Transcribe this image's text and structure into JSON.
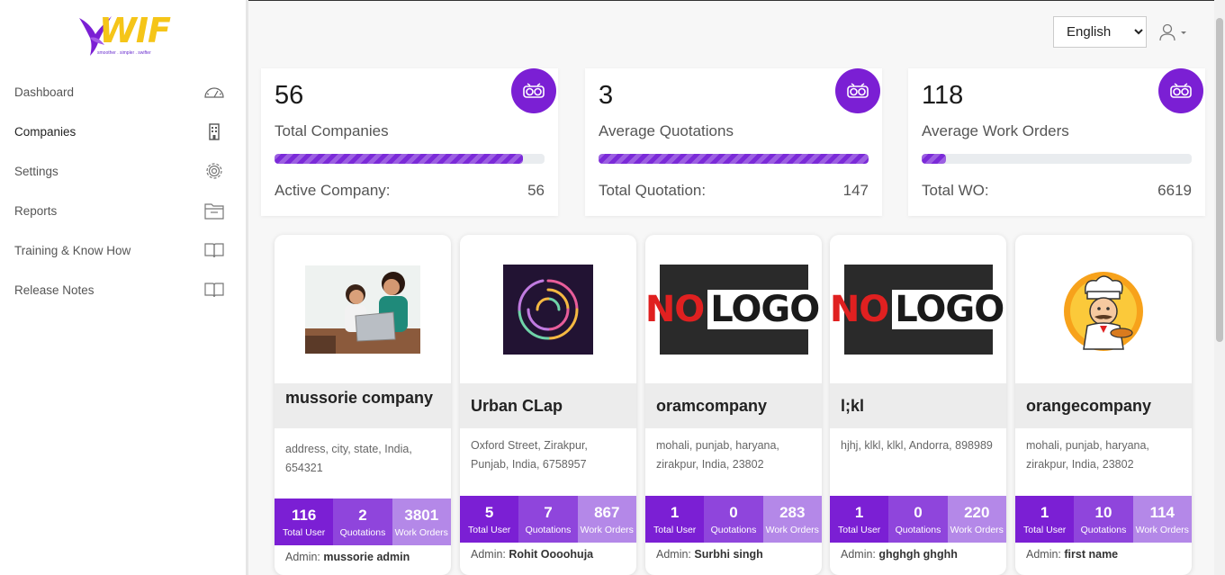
{
  "brand": {
    "name": "WIF",
    "tagline": "smoother . simpler . swifter"
  },
  "sidebar": {
    "items": [
      {
        "label": "Dashboard",
        "icon": "speedometer-icon"
      },
      {
        "label": "Companies",
        "icon": "building-icon"
      },
      {
        "label": "Settings",
        "icon": "gear-icon"
      },
      {
        "label": "Reports",
        "icon": "folder-icon"
      },
      {
        "label": "Training & Know How",
        "icon": "book-icon"
      },
      {
        "label": "Release Notes",
        "icon": "book-icon"
      }
    ]
  },
  "header": {
    "language": "English",
    "language_options": [
      "English"
    ]
  },
  "stats": [
    {
      "value": "56",
      "label": "Total Companies",
      "progress": 0.92,
      "foot_label": "Active Company:",
      "foot_value": "56"
    },
    {
      "value": "3",
      "label": "Average Quotations",
      "progress": 1.0,
      "foot_label": "Total Quotation:",
      "foot_value": "147"
    },
    {
      "value": "118",
      "label": "Average Work Orders",
      "progress": 0.09,
      "foot_label": "Total WO:",
      "foot_value": "6619"
    }
  ],
  "companies": [
    {
      "name": "mussorie company",
      "address": "address, city, state, India, 654321",
      "logo": "photo-logo",
      "users": "116",
      "quotations": "2",
      "work_orders": "3801",
      "admin": "mussorie admin"
    },
    {
      "name": "Urban CLap",
      "address": "Oxford Street, Zirakpur, Punjab, India, 6758957",
      "logo": "abstract-circle-logo",
      "users": "5",
      "quotations": "7",
      "work_orders": "867",
      "admin": "Rohit Oooohuja"
    },
    {
      "name": "oramcompany",
      "address": "mohali, punjab, haryana, zirakpur, India, 23802",
      "logo": "no-logo",
      "users": "1",
      "quotations": "0",
      "work_orders": "283",
      "admin": "Surbhi singh"
    },
    {
      "name": "l;kl",
      "address": "hjhj, klkl, klkl, Andorra, 898989",
      "logo": "no-logo",
      "users": "1",
      "quotations": "0",
      "work_orders": "220",
      "admin": "ghghgh ghghh"
    },
    {
      "name": "orangecompany",
      "address": "mohali, punjab, haryana, zirakpur, India, 23802",
      "logo": "chef-logo",
      "users": "1",
      "quotations": "10",
      "work_orders": "114",
      "admin": "first name"
    }
  ],
  "labels": {
    "total_user": "Total User",
    "quotations": "Quotations",
    "work_orders": "Work Orders",
    "admin_prefix": "Admin:",
    "nologo_no": "NO",
    "nologo_logo": "LOGO"
  },
  "colors": {
    "accent": "#7b1fd4",
    "accent_mid": "#8f45dc",
    "accent_light": "#b488e8",
    "logo_yellow": "#f5c518"
  }
}
